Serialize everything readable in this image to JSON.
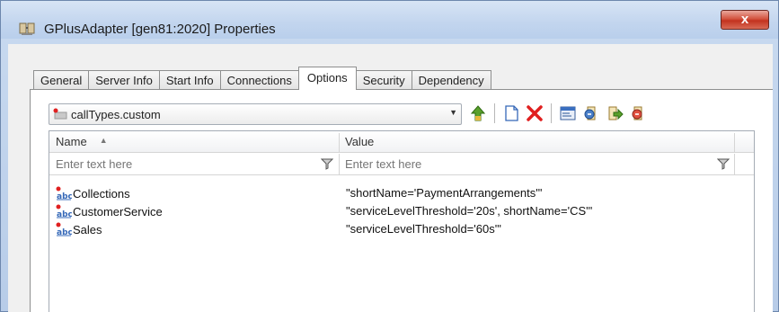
{
  "window": {
    "title": "GPlusAdapter [gen81:2020] Properties",
    "close_label": "x"
  },
  "tabs": [
    {
      "label": "General",
      "active": false
    },
    {
      "label": "Server Info",
      "active": false
    },
    {
      "label": "Start Info",
      "active": false
    },
    {
      "label": "Connections",
      "active": false
    },
    {
      "label": "Options",
      "active": true
    },
    {
      "label": "Security",
      "active": false
    },
    {
      "label": "Dependency",
      "active": false
    }
  ],
  "section_combo": {
    "selected": "callTypes.custom"
  },
  "toolbar": {
    "icons": [
      "move-up-icon",
      "new-item-icon",
      "delete-icon",
      "view-icon",
      "import-icon",
      "export-icon",
      "copy-icon"
    ]
  },
  "grid": {
    "columns": {
      "name": "Name",
      "value": "Value"
    },
    "filters": {
      "name_placeholder": "Enter text here",
      "value_placeholder": "Enter text here"
    },
    "rows": [
      {
        "name": "Collections",
        "value": "\"shortName='PaymentArrangements'\""
      },
      {
        "name": "CustomerService",
        "value": "\"serviceLevelThreshold='20s', shortName='CS'\""
      },
      {
        "name": "Sales",
        "value": "\"serviceLevelThreshold='60s'\""
      }
    ]
  },
  "colors": {
    "accent": "#3568b8",
    "delete": "#e02020",
    "close_button": "#c9402c"
  }
}
